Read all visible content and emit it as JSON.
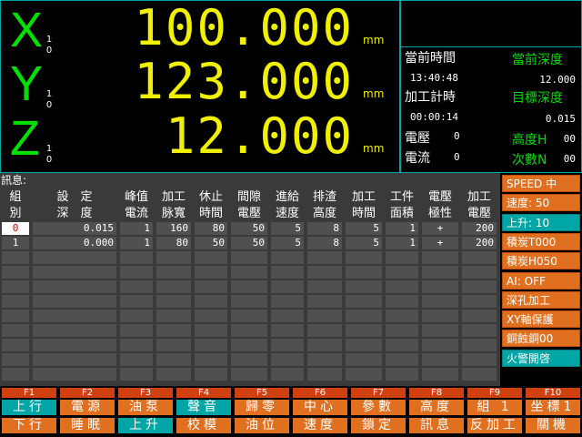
{
  "dro": {
    "axes": [
      {
        "letter": "X",
        "sub1": "1",
        "sub2": "0",
        "value": "100.000",
        "unit": "mm"
      },
      {
        "letter": "Y",
        "sub1": "1",
        "sub2": "0",
        "value": "123.000",
        "unit": "mm"
      },
      {
        "letter": "Z",
        "sub1": "1",
        "sub2": "0",
        "value": "12.000",
        "unit": "mm"
      }
    ]
  },
  "status": {
    "current_time_label": "當前時間",
    "current_time": "13:40:48",
    "current_depth_label": "當前深度",
    "current_depth": "12.000",
    "machining_timer_label": "加工計時",
    "machining_timer": "00:00:14",
    "target_depth_label": "目標深度",
    "target_depth": "0.015",
    "voltage_label": "電壓",
    "voltage": "0",
    "height_label": "高度H",
    "height": "00",
    "current_label": "電流",
    "current": "0",
    "count_label": "次數N",
    "count": "00"
  },
  "message": {
    "label": "訊息:"
  },
  "table": {
    "headers": [
      {
        "l1": "組",
        "l2": "別"
      },
      {
        "l1": "設　定",
        "l2": "深　度"
      },
      {
        "l1": "峰值",
        "l2": "電流"
      },
      {
        "l1": "加工",
        "l2": "脉寬"
      },
      {
        "l1": "休止",
        "l2": "時間"
      },
      {
        "l1": "間隙",
        "l2": "電壓"
      },
      {
        "l1": "進給",
        "l2": "速度"
      },
      {
        "l1": "排渣",
        "l2": "高度"
      },
      {
        "l1": "加工",
        "l2": "時間"
      },
      {
        "l1": "工件",
        "l2": "面積"
      },
      {
        "l1": "電壓",
        "l2": "極性"
      },
      {
        "l1": "加工",
        "l2": "電壓"
      }
    ],
    "rows": [
      [
        "0",
        "0.015",
        "1",
        "160",
        "80",
        "50",
        "5",
        "8",
        "5",
        "1",
        "+",
        "200"
      ],
      [
        "1",
        "0.000",
        "1",
        "80",
        "50",
        "50",
        "5",
        "8",
        "5",
        "1",
        "+",
        "200"
      ]
    ]
  },
  "right_menu": [
    "SPEED 中",
    "速度: 50",
    "上升: 10",
    "積炭T000",
    "積炭H050",
    "AI: OFF",
    "深孔加工",
    "XY軸保護",
    "銅蝕銅00",
    "火警開啓"
  ],
  "fkeys": [
    {
      "key": "F1",
      "top": "上行",
      "bottom": "下行"
    },
    {
      "key": "F2",
      "top": "電源",
      "bottom": "睡眠"
    },
    {
      "key": "F3",
      "top": "油泵",
      "bottom": "上升"
    },
    {
      "key": "F4",
      "top": "聲音",
      "bottom": "校模"
    },
    {
      "key": "F5",
      "top": "歸零",
      "bottom": "油位"
    },
    {
      "key": "F6",
      "top": "中心",
      "bottom": "速度"
    },
    {
      "key": "F7",
      "top": "參數",
      "bottom": "鎖定"
    },
    {
      "key": "F8",
      "top": "高度",
      "bottom": "訊息"
    },
    {
      "key": "F9",
      "top": "組 1",
      "bottom": "反加工"
    },
    {
      "key": "F10",
      "top": "坐標1",
      "bottom": "關機"
    }
  ],
  "colors": {
    "accent": "#e07020",
    "teal": "#00a6a6",
    "dro_value": "#f0f000",
    "axis_letter": "#00e000"
  }
}
